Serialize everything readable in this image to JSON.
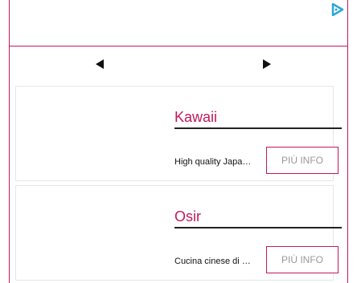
{
  "ad": {
    "icon": "adchoices-icon"
  },
  "nav": {
    "prev_icon": "arrow-left-icon",
    "next_icon": "arrow-right-icon"
  },
  "colors": {
    "accent": "#c2185b",
    "underline": "#222222",
    "button_text": "#999999"
  },
  "cards": [
    {
      "title": "Kawaii",
      "description": "High quality Japa…",
      "button_label": "PIÙ INFO"
    },
    {
      "title": "Osir",
      "description": "Cucina cinese di …",
      "button_label": "PIÙ INFO"
    }
  ]
}
